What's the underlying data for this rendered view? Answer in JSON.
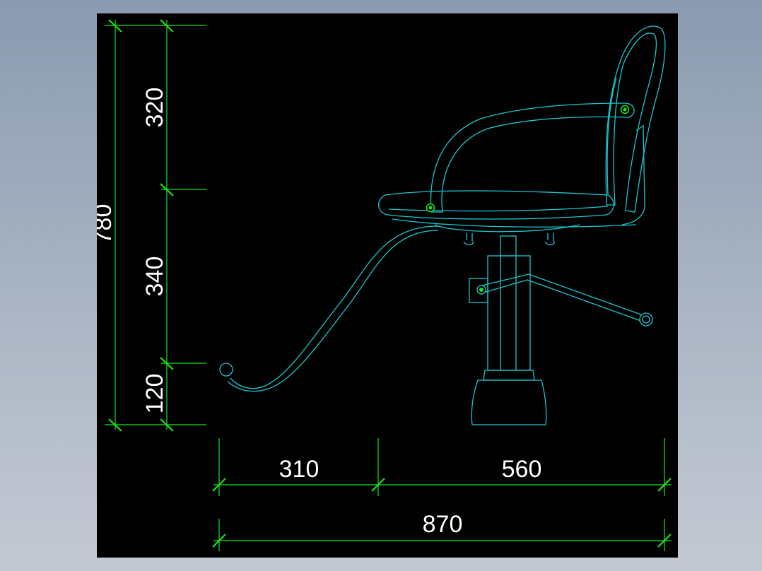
{
  "drawing": {
    "title": "",
    "colors": {
      "background": "#000000",
      "dimension": "#19e619",
      "outline": "#19c8d2",
      "text": "#ffffff",
      "frame_outer": "#8a9bb0"
    },
    "vertical_dimensions": {
      "overall": "780",
      "top": "320",
      "middle": "340",
      "bottom": "120"
    },
    "horizontal_dimensions": {
      "left": "310",
      "right": "560",
      "overall": "870"
    }
  }
}
